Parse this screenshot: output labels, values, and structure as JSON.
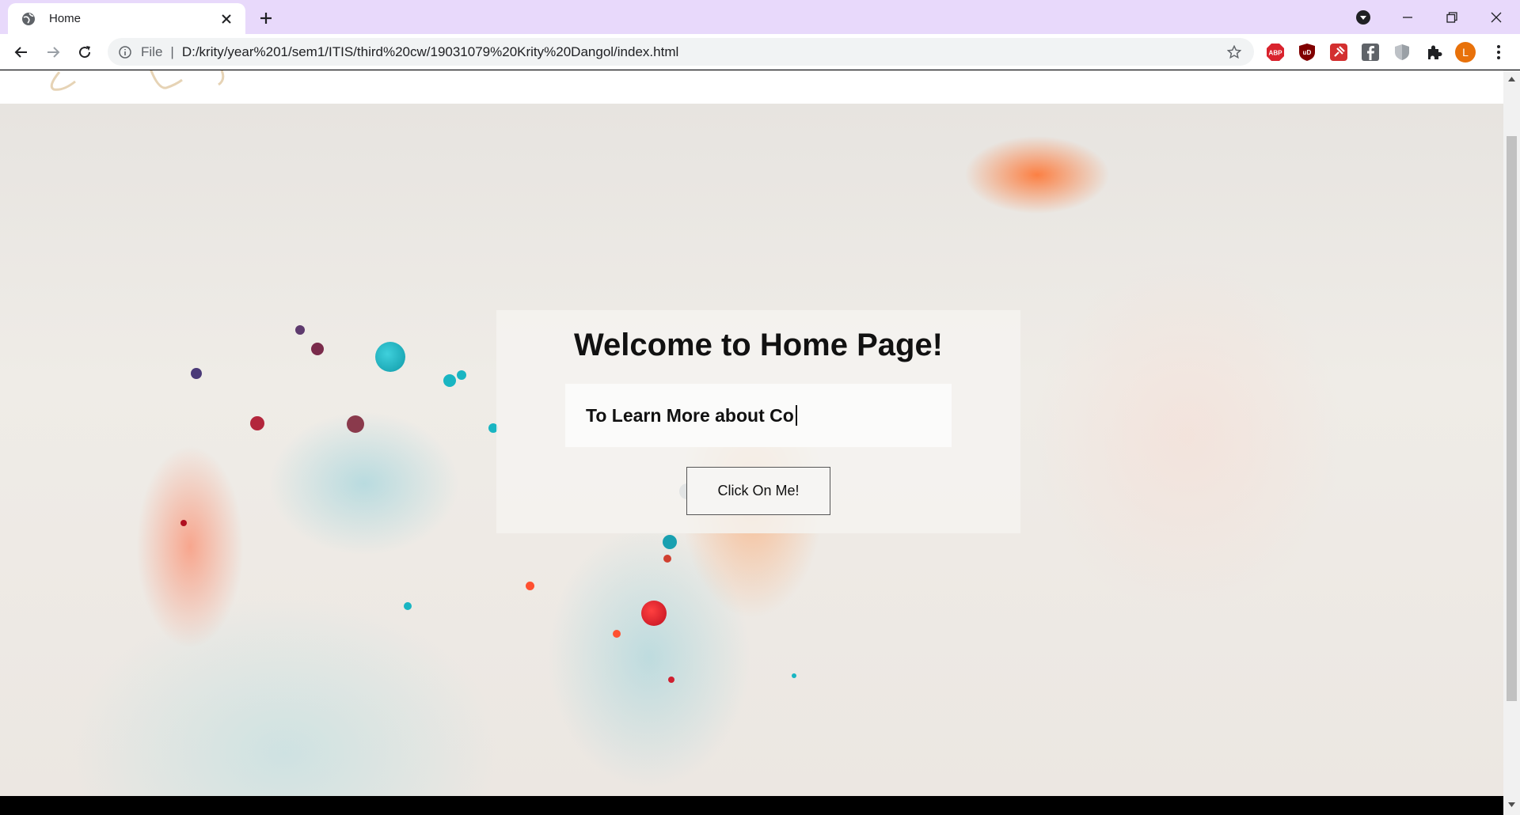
{
  "browser": {
    "tab": {
      "title": "Home",
      "favicon": "globe-icon",
      "close": "close-icon"
    },
    "new_tab": "plus-icon",
    "window_controls": [
      "media-control-icon",
      "minimize-icon",
      "restore-icon",
      "close-icon"
    ],
    "nav": [
      "back-arrow-icon",
      "forward-arrow-icon",
      "reload-icon"
    ],
    "address": {
      "scheme_label": "File",
      "separator": "|",
      "url": "D:/krity/year%201/sem1/ITIS/third%20cw/19031079%20Krity%20Dangol/index.html"
    },
    "extensions": [
      {
        "name": "adblock-plus-icon",
        "label": "ABP",
        "color": "#d9232d"
      },
      {
        "name": "ublock-icon",
        "label": "uD",
        "color": "#800000"
      },
      {
        "name": "pin-extension-icon",
        "label": "",
        "color": "#d32f2f"
      },
      {
        "name": "facebook-icon",
        "label": "f",
        "color": "#5f6368"
      },
      {
        "name": "shield-icon",
        "label": "",
        "color": "#9aa0a6"
      },
      {
        "name": "puzzle-icon",
        "label": "",
        "color": "#202124"
      }
    ],
    "profile": {
      "initial": "L",
      "color": "#e8710a"
    }
  },
  "page": {
    "card": {
      "title": "Welcome to Home Page!",
      "typed_text": "To Learn More about Co",
      "button_label": "Click On Me!"
    }
  },
  "colors": {
    "tabbar": "#e8d9fb",
    "accent_orange": "#ff6e28",
    "accent_teal": "#19b5c2"
  }
}
